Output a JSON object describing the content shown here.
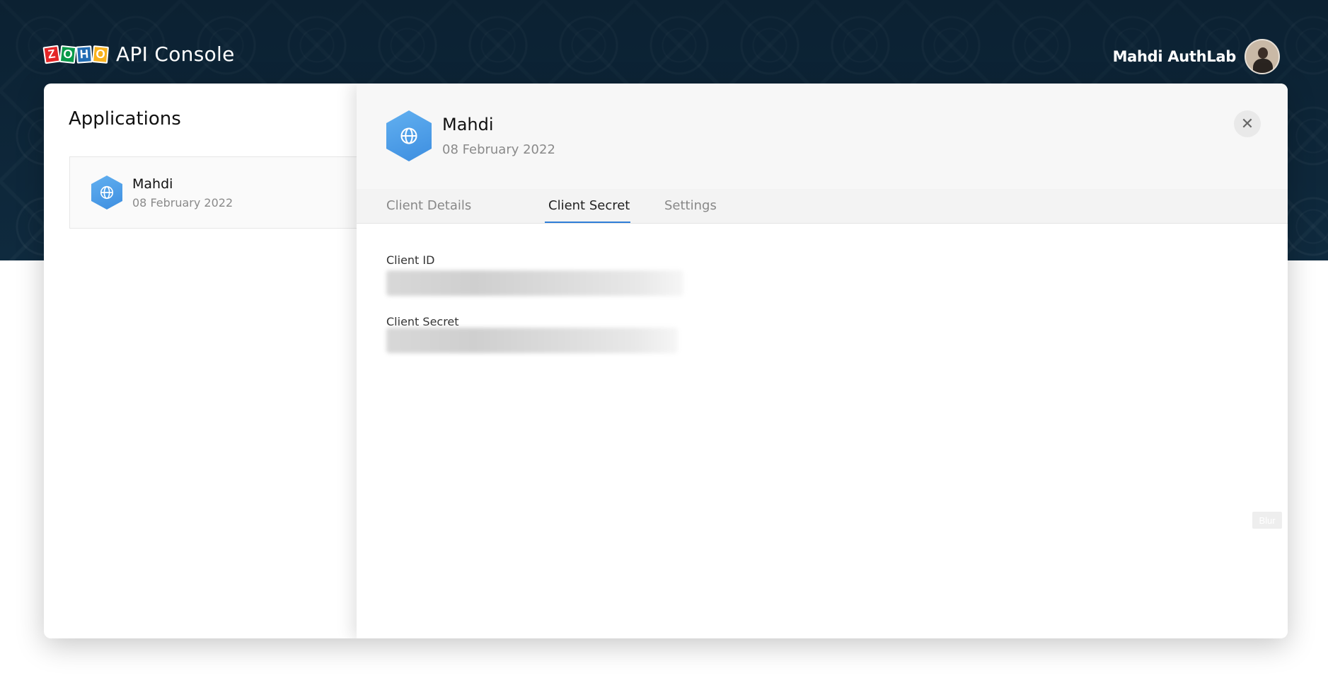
{
  "header": {
    "logo_letters": [
      "Z",
      "O",
      "H",
      "O"
    ],
    "logo_text": "API Console",
    "user_name": "Mahdi AuthLab"
  },
  "sidebar": {
    "title": "Applications",
    "apps": [
      {
        "name": "Mahdi",
        "date": "08 February 2022",
        "icon": "globe-icon"
      }
    ]
  },
  "detail": {
    "app_name": "Mahdi",
    "app_date": "08 February 2022",
    "close_icon": "close-icon",
    "tabs": [
      {
        "label": "Client Details",
        "active": false
      },
      {
        "label": "Client Secret",
        "active": true
      },
      {
        "label": "Settings",
        "active": false
      }
    ],
    "fields": [
      {
        "label": "Client ID"
      },
      {
        "label": "Client Secret"
      }
    ],
    "blur_toggle_label": "Blur"
  },
  "colors": {
    "hero_bg": "#0f2a3e",
    "accent": "#2f7ed8",
    "hex_icon": "#4a9ce6"
  }
}
